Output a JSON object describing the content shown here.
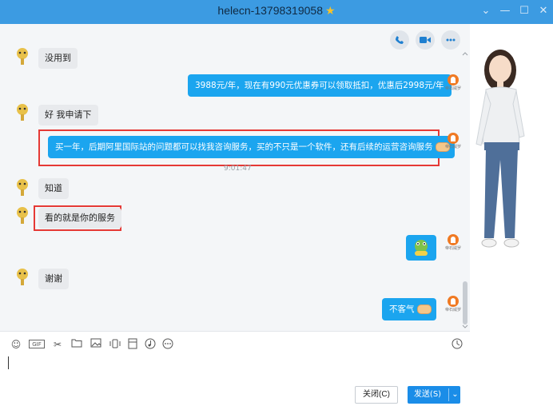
{
  "window": {
    "title": "helecn-13798319058",
    "title_star": "★",
    "controls": [
      "⌄",
      "—",
      "☐",
      "✕"
    ]
  },
  "call_bar": {
    "icons": [
      "phone-icon",
      "video-icon",
      "more-icon"
    ]
  },
  "messages": [
    {
      "side": "left",
      "text": "没用到"
    },
    {
      "side": "right",
      "text": "3988元/年，现在有990元优惠券可以领取抵扣，优惠后2998元/年"
    },
    {
      "side": "left",
      "text": "好  我申请下"
    },
    {
      "side": "right",
      "text": "买一年，后期阿里国际站的问题都可以找我咨询服务，买的不只是一个软件，还有后续的运营咨询服务",
      "highlighted": true
    },
    {
      "side": "left",
      "text": "知道"
    },
    {
      "side": "left",
      "text": "看的就是你的服务",
      "highlighted": true
    },
    {
      "side": "right",
      "type": "emoji"
    },
    {
      "side": "left",
      "text": "谢谢"
    },
    {
      "side": "right",
      "text": "不客气"
    }
  ],
  "timestamp": "9:01:47",
  "brand_avatar_label": "帝石威罗",
  "toolbar": {
    "icons": [
      "emoji-icon",
      "gif-icon",
      "scissors-icon",
      "folder-icon",
      "image-icon",
      "shake-icon",
      "red-packet-icon",
      "music-icon",
      "more-icon",
      "history-icon"
    ],
    "gif_label": "GIF"
  },
  "buttons": {
    "close": "关闭(C)",
    "send": "发送(S)"
  },
  "colors": {
    "titlebar": "#3c9be2",
    "bubble_right": "#1ba5ef",
    "bubble_left": "#e8eaed",
    "highlight": "#e53935",
    "send_button": "#1a8de8"
  }
}
